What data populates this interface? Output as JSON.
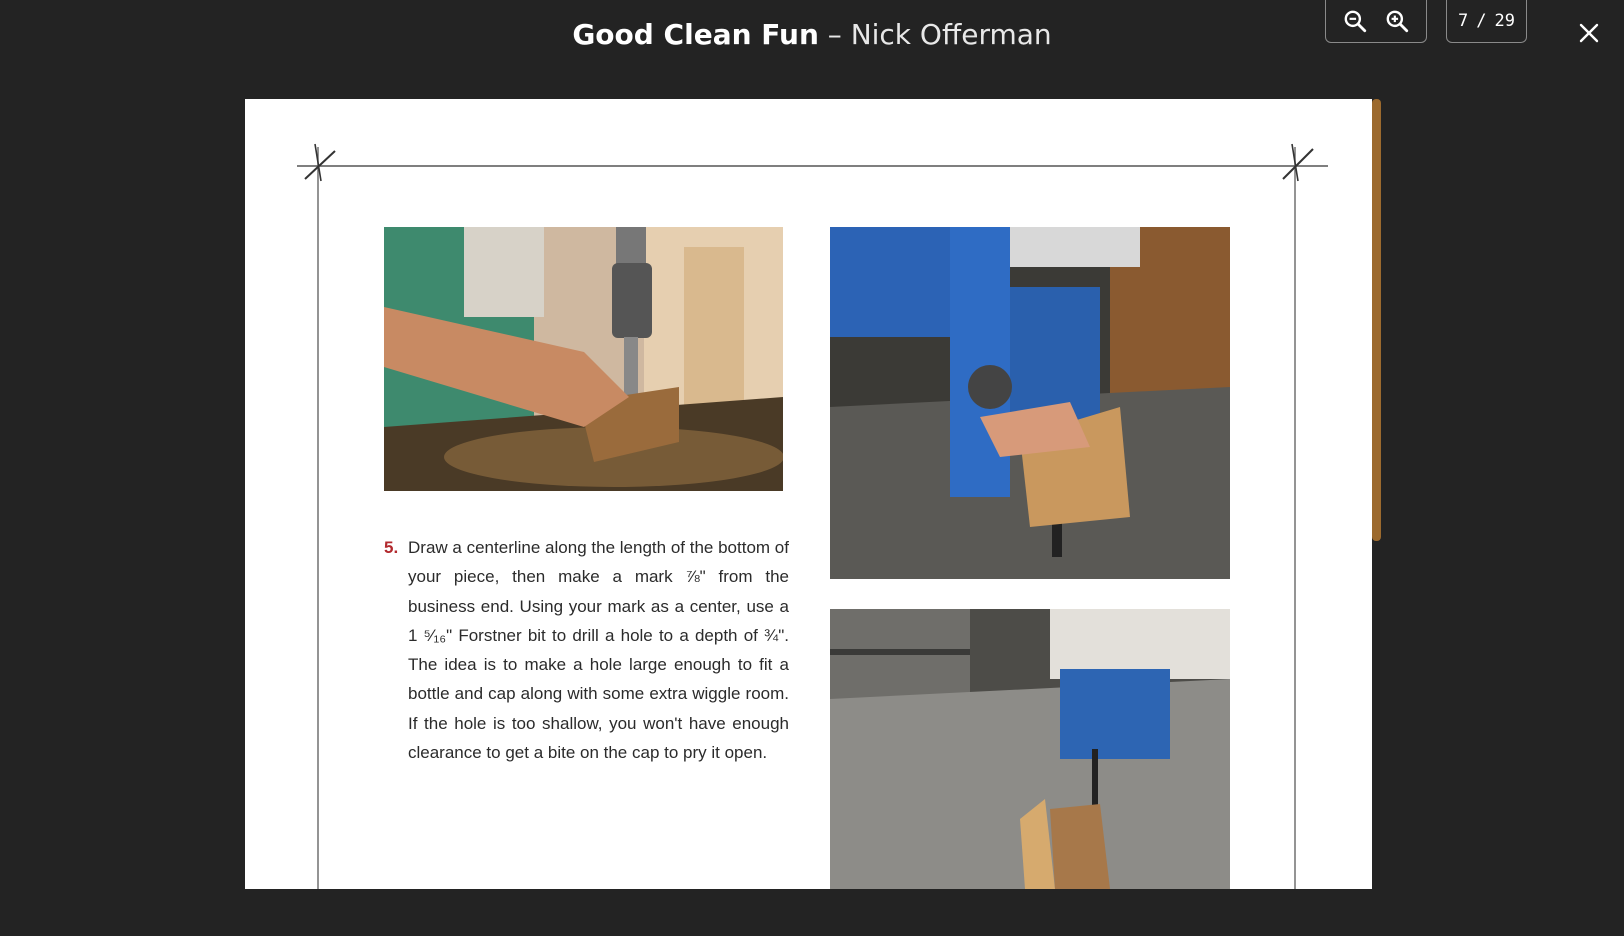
{
  "header": {
    "book_title": "Good Clean Fun",
    "separator": "–",
    "author": "Nick Offerman"
  },
  "toolbar": {
    "zoom_out_icon": "zoom-out-icon",
    "zoom_in_icon": "zoom-in-icon",
    "current_page": "7",
    "page_separator": "/",
    "total_pages": "29",
    "close_icon": "close-icon"
  },
  "content": {
    "step_number": "5.",
    "step_text": "Draw a centerline along the length of the bottom of your piece, then make a mark ⅞\" from the business end. Using your mark as a center, use a 1 ⁵⁄₁₆\" Forstner bit to drill a hole to a depth of ¾\". The idea is to make a hole large enough to fit a bottle and cap along with some extra wiggle room. If the hole is too shallow, you won't have enough clearance to get a bite on the cap to pry it open."
  },
  "colors": {
    "background": "#232323",
    "page": "#ffffff",
    "scroll_thumb": "#9c6a2e",
    "step_number": "#b22a2e"
  }
}
